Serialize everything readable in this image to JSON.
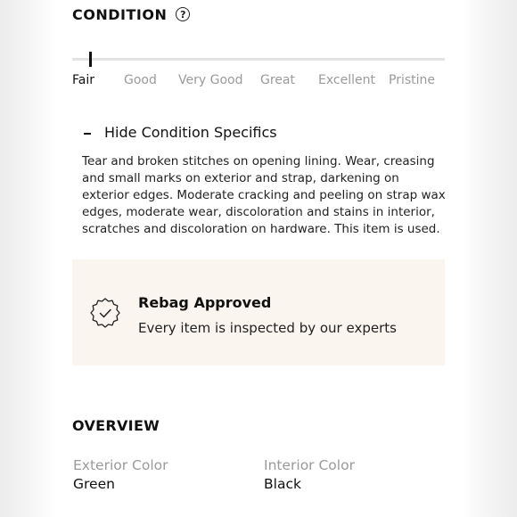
{
  "condition": {
    "title": "CONDITION",
    "help_icon": "?",
    "grades": [
      "Fair",
      "Good",
      "Very Good",
      "Great",
      "Excellent",
      "Pristine"
    ],
    "selected_grade": "Fair",
    "toggle_label": "Hide Condition Specifics",
    "specifics": "Tear and broken stitches on opening lining. Wear, creasing and small marks on exterior and strap, darkening on exterior edges. Moderate cracking and peeling on strap wax edges, moderate wear, discoloration and stains in interior, scratches and discoloration on hardware. This item is used."
  },
  "approval": {
    "icon": "checkmark-badge-icon",
    "title": "Rebag Approved",
    "subtitle": "Every item is inspected by our experts"
  },
  "overview": {
    "title": "OVERVIEW",
    "attributes": [
      {
        "label": "Exterior Color",
        "value": "Green"
      },
      {
        "label": "Interior Color",
        "value": "Black"
      }
    ]
  },
  "colors": {
    "approval_background": "#faf5ef",
    "inactive_text": "#9a9a9a",
    "primary_text": "#111111"
  }
}
